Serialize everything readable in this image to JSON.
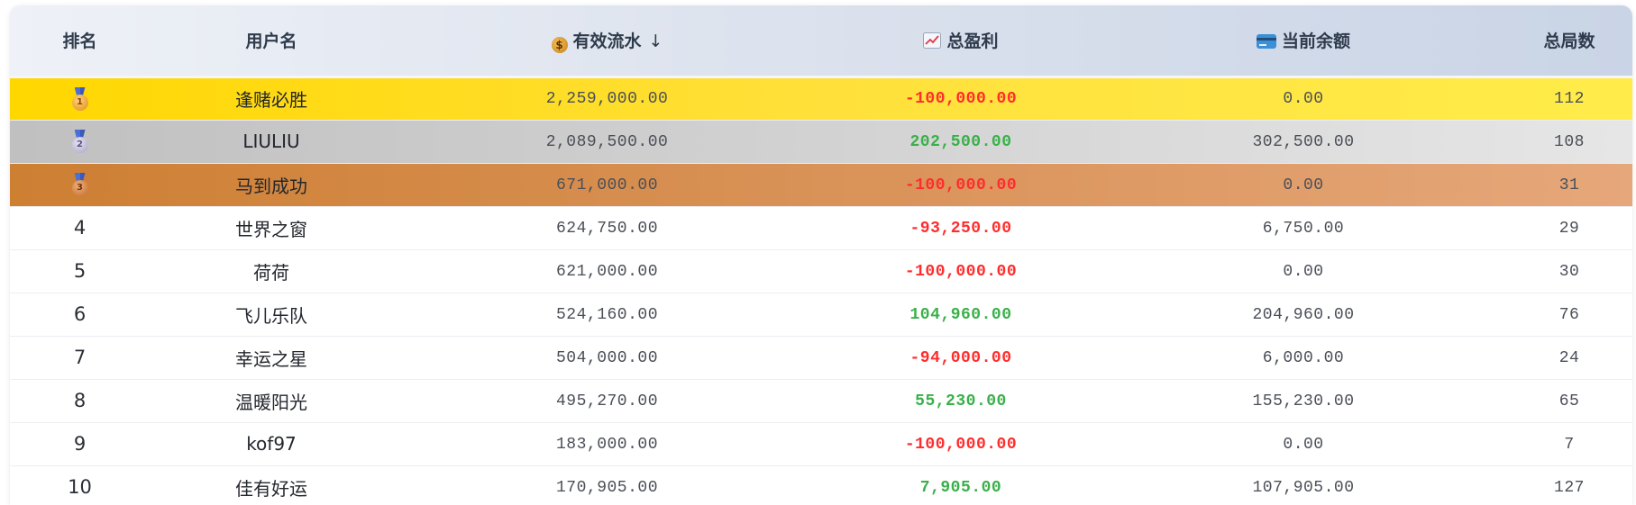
{
  "columns": {
    "rank": "排名",
    "username": "用户名",
    "flow": "有效流水",
    "flow_sort_indicator": "↓",
    "profit": "总盈利",
    "balance": "当前余额",
    "games": "总局数"
  },
  "icons": {
    "flow": "money-bag-icon",
    "profit": "chart-increasing-icon",
    "balance": "credit-card-icon",
    "rank_1": "first-place-medal-icon",
    "rank_2": "second-place-medal-icon",
    "rank_3": "third-place-medal-icon"
  },
  "colors": {
    "gold_row": "#ffd700",
    "silver_row": "#c0c0c0",
    "bronze_row": "#cd7f32",
    "profit_negative": "#ff2d2d",
    "profit_positive": "#3ab04a"
  },
  "rows": [
    {
      "rank": "1",
      "medal": "1",
      "username": "逢赌必胜",
      "flow": "2,259,000.00",
      "profit": "-100,000.00",
      "balance": "0.00",
      "games": "112"
    },
    {
      "rank": "2",
      "medal": "2",
      "username": "LIULIU",
      "flow": "2,089,500.00",
      "profit": "202,500.00",
      "balance": "302,500.00",
      "games": "108"
    },
    {
      "rank": "3",
      "medal": "3",
      "username": "马到成功",
      "flow": "671,000.00",
      "profit": "-100,000.00",
      "balance": "0.00",
      "games": "31"
    },
    {
      "rank": "4",
      "username": "世界之窗",
      "flow": "624,750.00",
      "profit": "-93,250.00",
      "balance": "6,750.00",
      "games": "29"
    },
    {
      "rank": "5",
      "username": "荷荷",
      "flow": "621,000.00",
      "profit": "-100,000.00",
      "balance": "0.00",
      "games": "30"
    },
    {
      "rank": "6",
      "username": "飞儿乐队",
      "flow": "524,160.00",
      "profit": "104,960.00",
      "balance": "204,960.00",
      "games": "76"
    },
    {
      "rank": "7",
      "username": "幸运之星",
      "flow": "504,000.00",
      "profit": "-94,000.00",
      "balance": "6,000.00",
      "games": "24"
    },
    {
      "rank": "8",
      "username": "温暖阳光",
      "flow": "495,270.00",
      "profit": "55,230.00",
      "balance": "155,230.00",
      "games": "65"
    },
    {
      "rank": "9",
      "username": "kof97",
      "flow": "183,000.00",
      "profit": "-100,000.00",
      "balance": "0.00",
      "games": "7"
    },
    {
      "rank": "10",
      "username": "佳有好运",
      "flow": "170,905.00",
      "profit": "7,905.00",
      "balance": "107,905.00",
      "games": "127"
    }
  ]
}
